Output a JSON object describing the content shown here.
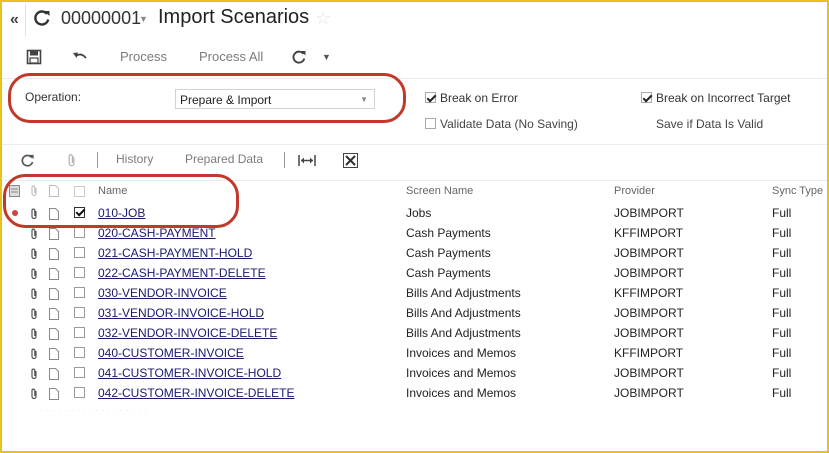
{
  "header": {
    "back_glyph": "«",
    "document_id": "00000001",
    "title": "Import Scenarios"
  },
  "toolbar": {
    "process_label": "Process",
    "process_all_label": "Process All"
  },
  "form": {
    "operation_label": "Operation:",
    "operation_value": "Prepare & Import",
    "break_on_error": {
      "label": "Break on Error",
      "checked": true
    },
    "break_on_incorrect_target": {
      "label": "Break on Incorrect Target",
      "checked": true
    },
    "validate_data": {
      "label": "Validate Data (No Saving)",
      "checked": false
    },
    "save_if_valid": {
      "label": "Save if Data Is Valid",
      "checked": false
    }
  },
  "grid_toolbar": {
    "history_label": "History",
    "prepared_data_label": "Prepared Data"
  },
  "table": {
    "columns": [
      "Name",
      "Screen Name",
      "Provider",
      "Sync Type"
    ],
    "rows": [
      {
        "name": "010-JOB",
        "screen": "Jobs",
        "provider": "JOBIMPORT",
        "sync": "Full",
        "selected": true
      },
      {
        "name": "020-CASH-PAYMENT",
        "screen": "Cash Payments",
        "provider": "KFFIMPORT",
        "sync": "Full",
        "selected": false
      },
      {
        "name": "021-CASH-PAYMENT-HOLD",
        "screen": "Cash Payments",
        "provider": "JOBIMPORT",
        "sync": "Full",
        "selected": false
      },
      {
        "name": "022-CASH-PAYMENT-DELETE",
        "screen": "Cash Payments",
        "provider": "JOBIMPORT",
        "sync": "Full",
        "selected": false
      },
      {
        "name": "030-VENDOR-INVOICE",
        "screen": "Bills And Adjustments",
        "provider": "KFFIMPORT",
        "sync": "Full",
        "selected": false
      },
      {
        "name": "031-VENDOR-INVOICE-HOLD",
        "screen": "Bills And Adjustments",
        "provider": "JOBIMPORT",
        "sync": "Full",
        "selected": false
      },
      {
        "name": "032-VENDOR-INVOICE-DELETE",
        "screen": "Bills And Adjustments",
        "provider": "JOBIMPORT",
        "sync": "Full",
        "selected": false
      },
      {
        "name": "040-CUSTOMER-INVOICE",
        "screen": "Invoices and Memos",
        "provider": "KFFIMPORT",
        "sync": "Full",
        "selected": false
      },
      {
        "name": "041-CUSTOMER-INVOICE-HOLD",
        "screen": "Invoices and Memos",
        "provider": "JOBIMPORT",
        "sync": "Full",
        "selected": false
      },
      {
        "name": "042-CUSTOMER-INVOICE-DELETE",
        "screen": "Invoices and Memos",
        "provider": "JOBIMPORT",
        "sync": "Full",
        "selected": false
      }
    ]
  },
  "colors": {
    "highlight": "#c0392b",
    "frame": "#e8c21a",
    "link": "#1a1a6e"
  }
}
